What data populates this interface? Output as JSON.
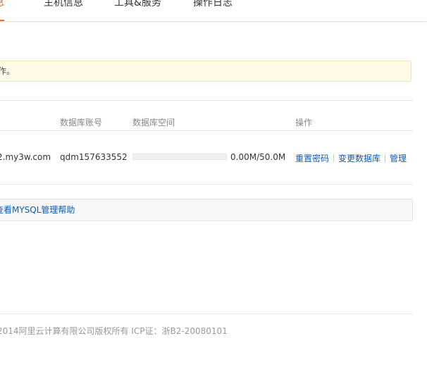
{
  "tabs": [
    {
      "label": "信息",
      "active": true
    },
    {
      "label": "主机信息",
      "active": false
    },
    {
      "label": "工具&服务",
      "active": false
    },
    {
      "label": "操作日志",
      "active": false
    }
  ],
  "notice": {
    "text": "作。"
  },
  "table": {
    "headers": {
      "account": "数据库账号",
      "space": "数据库空间",
      "ops": "操作"
    },
    "row": {
      "host": "2.my3w.com",
      "account": "qdm157633552",
      "usage_text": "0.00M/50.0M",
      "usage_fraction": 0.0
    },
    "ops": {
      "reset_password": "重置密码",
      "change_database": "变更数据库",
      "manage": "管理"
    }
  },
  "help": {
    "link_text": "查看MYSQL管理帮助"
  },
  "footer": {
    "text": "2014阿里云计算有限公司版权所有 ICP证：浙B2-20080101"
  },
  "colors": {
    "accent": "#ff6a00",
    "link": "#0d5bb4",
    "notice_bg": "#fffbe6"
  }
}
